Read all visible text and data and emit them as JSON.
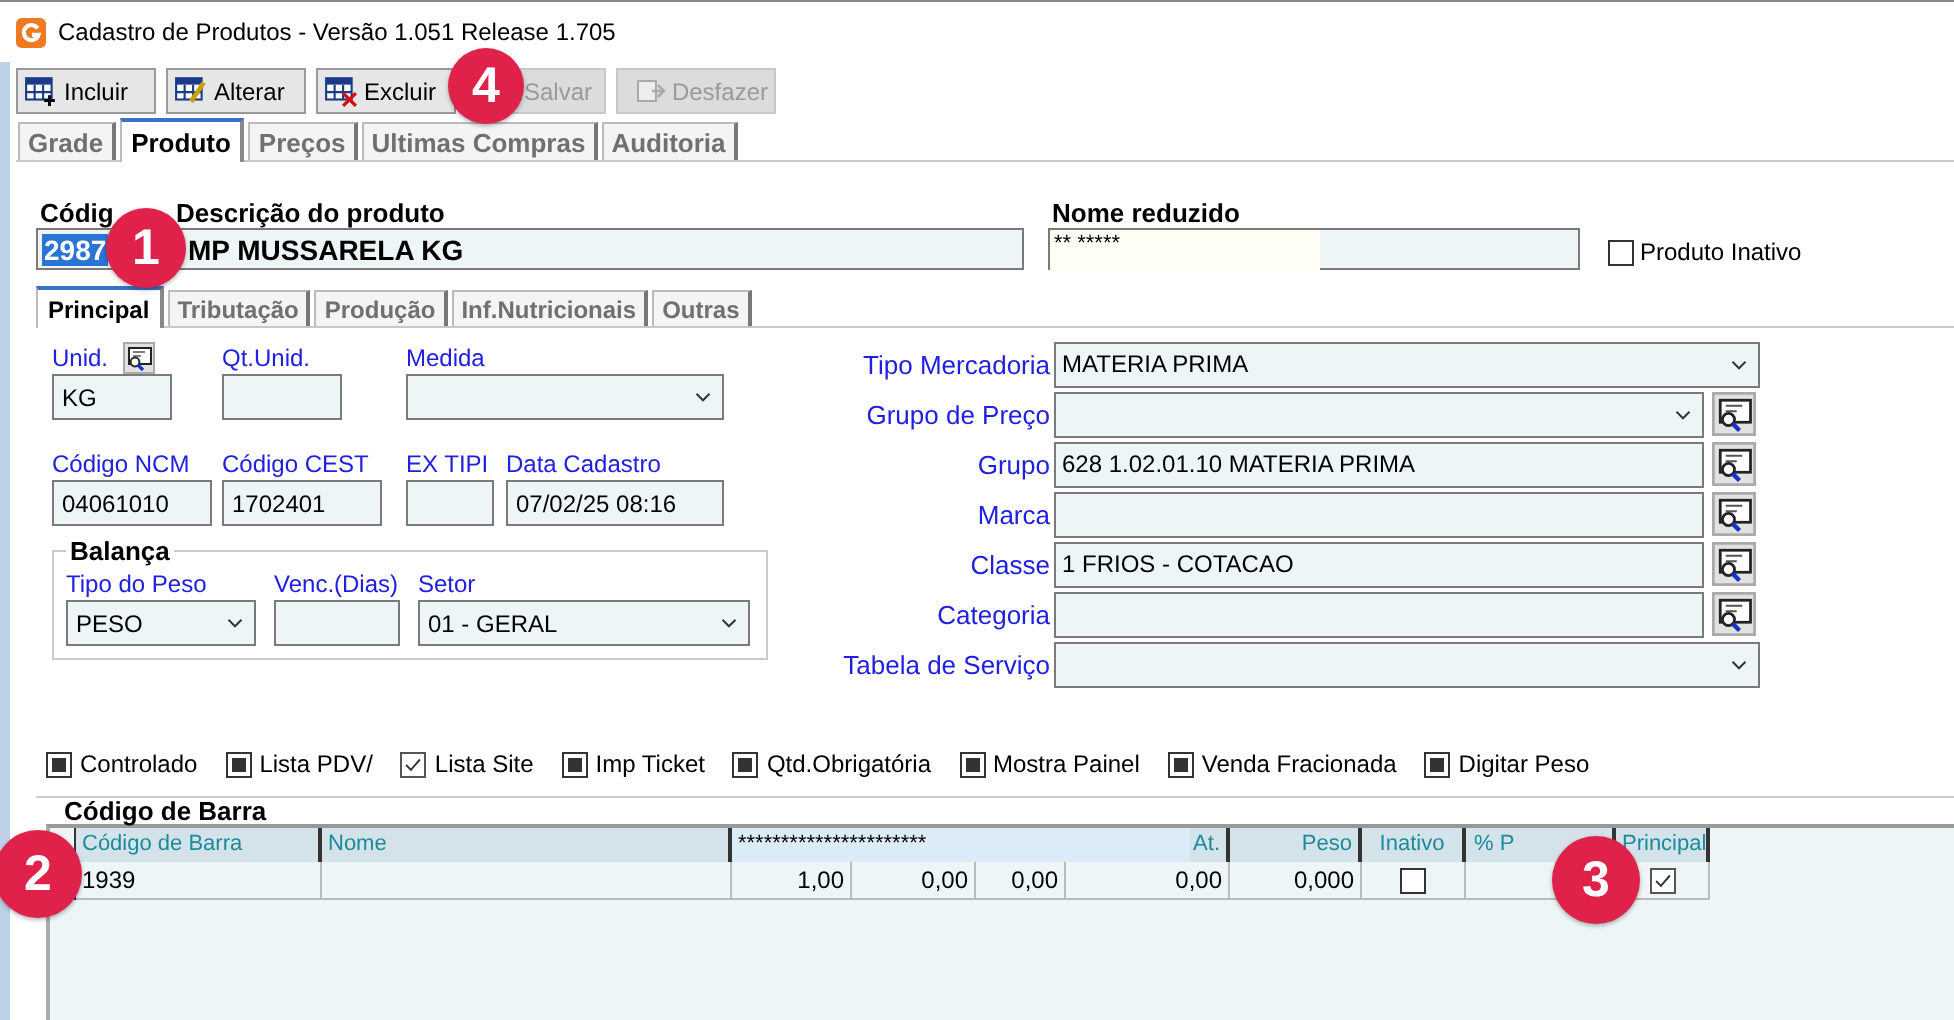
{
  "window": {
    "title": "Cadastro de Produtos - Versão 1.051 Release 1.705"
  },
  "toolbar": [
    {
      "label": "Incluir",
      "disabled": false
    },
    {
      "label": "Alterar",
      "disabled": false
    },
    {
      "label": "Excluir",
      "disabled": false
    },
    {
      "label": "Salvar",
      "disabled": true
    },
    {
      "label": "Desfazer",
      "disabled": true
    }
  ],
  "tabs": [
    {
      "label": "Grade",
      "selected": false
    },
    {
      "label": "Produto",
      "selected": true
    },
    {
      "label": "Preços",
      "selected": false
    },
    {
      "label": "Ultimas Compras",
      "selected": false
    },
    {
      "label": "Auditoria",
      "selected": false
    }
  ],
  "header": {
    "codigo": {
      "label": "Códig",
      "value": "2987"
    },
    "descricao": {
      "label": "Descrição do produto",
      "value": "MP MUSSARELA KG"
    },
    "nome_reduzido": {
      "label": "Nome reduzido",
      "value": "** *****"
    },
    "inativo": {
      "label": "Produto Inativo",
      "checked": false
    }
  },
  "subtabs": [
    {
      "label": "Principal",
      "selected": true
    },
    {
      "label": "Tributação",
      "selected": false
    },
    {
      "label": "Produção",
      "selected": false
    },
    {
      "label": "Inf.Nutricionais",
      "selected": false
    },
    {
      "label": "Outras",
      "selected": false
    }
  ],
  "left_rows": [
    [
      {
        "label": "Unid.",
        "value": "KG",
        "kind": "text",
        "lookup": true
      },
      {
        "label": "Qt.Unid.",
        "kind": "text",
        "lookup": false
      },
      {
        "label": "Medida",
        "kind": "select",
        "lookup": false
      }
    ],
    [
      {
        "label": "Código NCM",
        "value": "04061010",
        "kind": "text",
        "lookup": false
      },
      {
        "label": "Código CEST",
        "value": "1702401",
        "kind": "text",
        "lookup": false
      },
      {
        "label": "EX TIPI",
        "kind": "text",
        "lookup": false
      },
      {
        "label": "Data Cadastro",
        "value": "07/02/25 08:16",
        "kind": "text",
        "lookup": false
      }
    ]
  ],
  "balanca": {
    "title": "Balança",
    "fields": [
      {
        "label": "Tipo do Peso",
        "value": "PESO",
        "kind": "select"
      },
      {
        "label": "Venc.(Dias)",
        "kind": "text"
      },
      {
        "label": "Setor",
        "value": "01 - GERAL",
        "kind": "select"
      }
    ]
  },
  "right_fields": [
    {
      "label": "Tipo Mercadoria",
      "value": "MATERIA PRIMA",
      "kind": "select",
      "lookup": false
    },
    {
      "label": "Grupo de Preço",
      "kind": "select",
      "lookup": true
    },
    {
      "label": "Grupo",
      "value": "628 1.02.01.10 MATERIA PRIMA",
      "kind": "text",
      "lookup": true
    },
    {
      "label": "Marca",
      "kind": "text",
      "lookup": true
    },
    {
      "label": "Classe",
      "value": "1 FRIOS - COTACAO",
      "kind": "text",
      "lookup": true
    },
    {
      "label": "Categoria",
      "kind": "text",
      "lookup": true
    },
    {
      "label": "Tabela de Serviço",
      "kind": "select",
      "lookup": false
    }
  ],
  "flags": [
    {
      "label": "Controlado",
      "checked": false,
      "grayed": true
    },
    {
      "label": "Lista PDV/",
      "checked": false,
      "grayed": true
    },
    {
      "label": "Lista Site",
      "checked": true,
      "grayed": false
    },
    {
      "label": "Imp Ticket",
      "checked": false,
      "grayed": true
    },
    {
      "label": "Qtd.Obrigatória",
      "checked": false,
      "grayed": true
    },
    {
      "label": "Mostra Painel",
      "checked": false,
      "grayed": true
    },
    {
      "label": "Venda Fracionada",
      "checked": false,
      "grayed": true
    },
    {
      "label": "Digitar Peso",
      "checked": false,
      "grayed": true
    }
  ],
  "barcodes": {
    "title": "Código de Barra",
    "columns": [
      {
        "label": "Código de Barra",
        "kind": "text"
      },
      {
        "label": "Nome",
        "kind": "text"
      },
      {
        "label": "**********************",
        "kind": "wide"
      },
      {
        "kind": "covered"
      },
      {
        "kind": "covered"
      },
      {
        "label": "At.",
        "kind": "num"
      },
      {
        "label": "Peso",
        "kind": "num"
      },
      {
        "label": "Inativo",
        "kind": "center"
      },
      {
        "label": "% P",
        "kind": "num"
      },
      {
        "label": "Principal",
        "kind": "center"
      }
    ],
    "rows": [
      [
        {
          "kind": "text",
          "value": "1939"
        },
        {
          "kind": "text"
        },
        {
          "kind": "num",
          "value": "1,00"
        },
        {
          "kind": "num",
          "value": "0,00"
        },
        {
          "kind": "num",
          "value": "0,00"
        },
        {
          "kind": "num",
          "value": "0,00"
        },
        {
          "kind": "num",
          "value": "0,000"
        },
        {
          "kind": "check",
          "checked": false
        },
        {
          "kind": "num"
        },
        {
          "kind": "check",
          "checked": true
        }
      ]
    ]
  },
  "callouts": [
    {
      "label": "1"
    },
    {
      "label": "2"
    },
    {
      "label": "3"
    },
    {
      "label": "4"
    }
  ]
}
